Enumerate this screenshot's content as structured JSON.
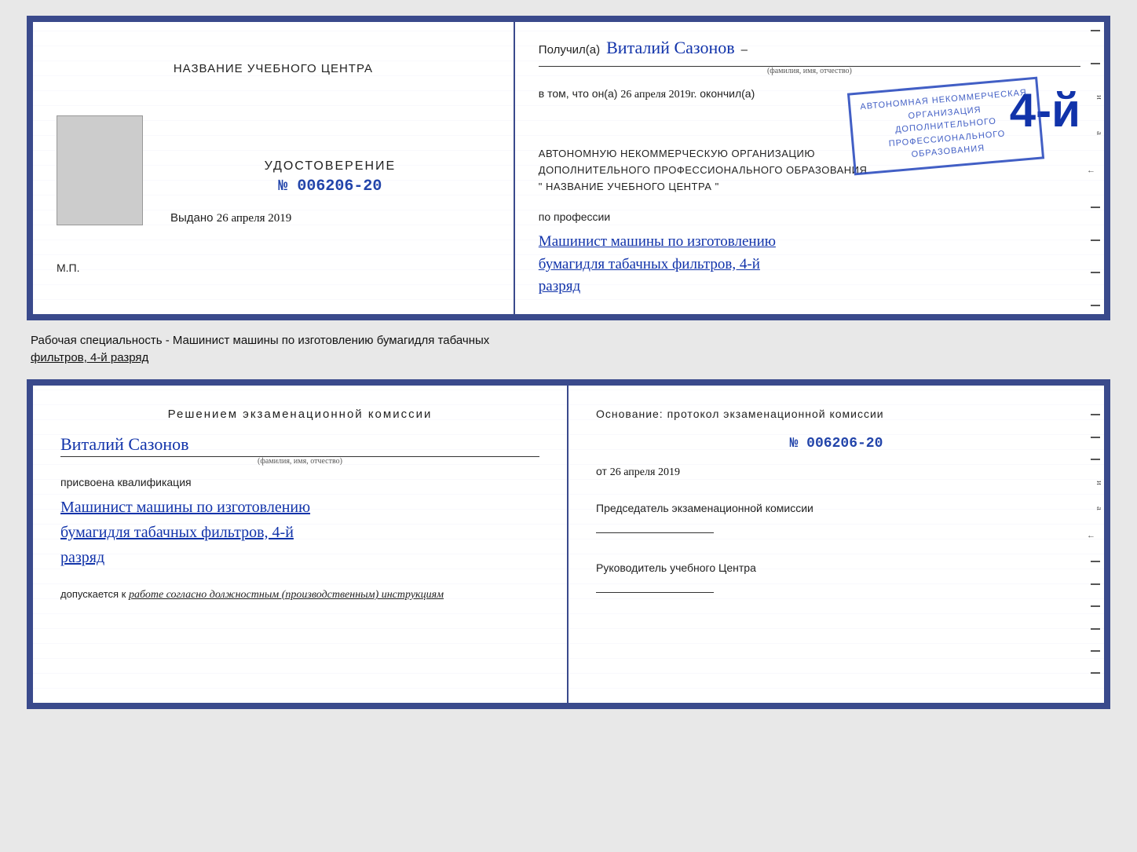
{
  "page": {
    "background": "#e8e8e8"
  },
  "top_cert": {
    "left": {
      "school_name": "НАЗВАНИЕ УЧЕБНОГО ЦЕНТРА",
      "udostoverenie_title": "УДОСТОВЕРЕНИЕ",
      "number": "№ 006206-20",
      "issued_label": "Выдано",
      "issued_date": "26 апреля 2019",
      "mp_label": "М.П."
    },
    "right": {
      "received_prefix": "Получил(а)",
      "recipient_name": "Виталий Сазонов",
      "recipient_label": "(фамилия, имя, отчество)",
      "date_prefix": "в том, что он(а)",
      "date_handwritten": "26 апреля 2019г.",
      "date_suffix": "окончил(а)",
      "big_number": "4-й",
      "org_line1": "АВТОНОМНУЮ НЕКОММЕРЧЕСКУЮ ОРГАНИЗАЦИЮ",
      "org_line2": "ДОПОЛНИТЕЛЬНОГО ПРОФЕССИОНАЛЬНОГО ОБРАЗОВАНИЯ",
      "org_line3": "\" НАЗВАНИЕ УЧЕБНОГО ЦЕНТРА \"",
      "profession_prefix": "по профессии",
      "profession_line1": "Машинист машины по изготовлению",
      "profession_line2": "бумагидля табачных фильтров, 4-й",
      "profession_line3": "разряд",
      "stamp_line1": "АВТОНОМНАЯ НЕКОММЕРЧЕСКАЯ",
      "stamp_line2": "ОРГАНИЗАЦИЯ",
      "stamp_line3": "ДОПОЛНИТЕЛЬНОГО",
      "stamp_line4": "ПРОФЕССИОНАЛЬНОГО",
      "stamp_line5": "ОБРАЗОВАНИЯ"
    }
  },
  "specialty_text": {
    "line1": "Рабочая специальность - Машинист машины по изготовлению бумагидля табачных",
    "line2": "фильтров, 4-й разряд"
  },
  "bottom_cert": {
    "left": {
      "commission_title": "Решением  экзаменационной  комиссии",
      "person_name": "Виталий Сазонов",
      "person_label": "(фамилия, имя, отчество)",
      "qualification_label": "присвоена квалификация",
      "qual_line1": "Машинист машины по изготовлению",
      "qual_line2": "бумагидля табачных фильтров, 4-й",
      "qual_line3": "разряд",
      "dopusk_prefix": "допускается к",
      "dopusk_text": "работе согласно должностным (производственным) инструкциям"
    },
    "right": {
      "osnov_title": "Основание: протокол экзаменационной  комиссии",
      "protocol_number": "№  006206-20",
      "date_prefix": "от",
      "date": "26 апреля 2019",
      "chairman_title": "Председатель экзаменационной комиссии",
      "director_title": "Руководитель учебного Центра"
    }
  }
}
